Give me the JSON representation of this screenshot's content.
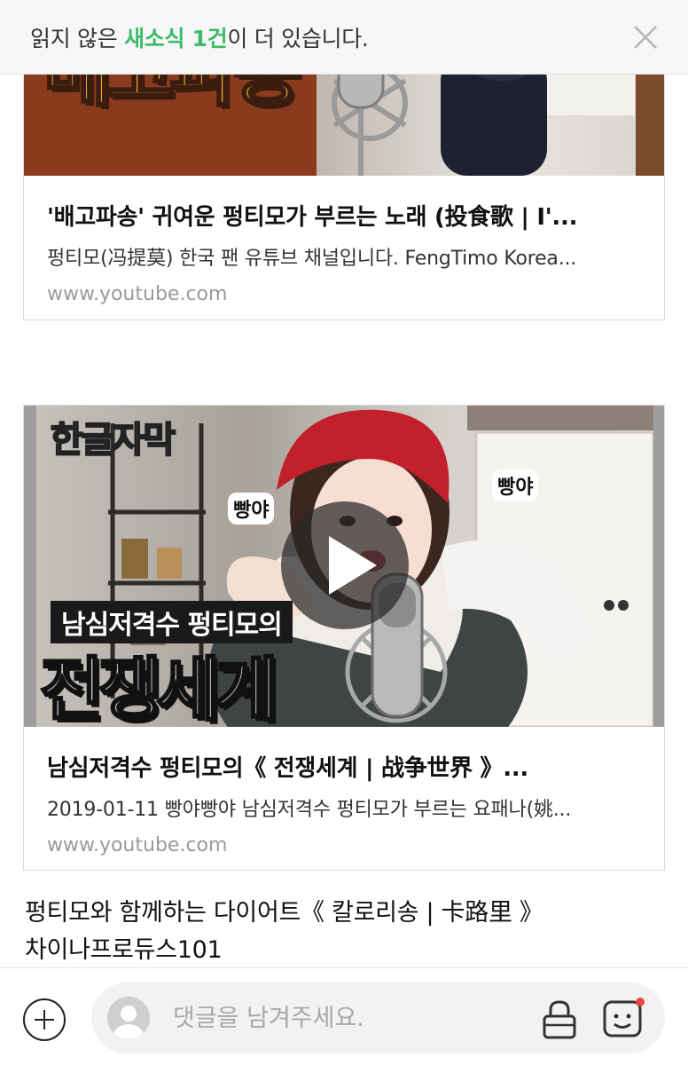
{
  "notice": {
    "prefix": "읽지 않은 ",
    "highlight": "새소식 1건",
    "suffix": "이 더 있습니다."
  },
  "cards": [
    {
      "thumb_caption": "배고파송",
      "title": "'배고파송' 귀여운 펑티모가 부르는 노래 (投食歌 | I'...",
      "desc": "펑티모(冯提莫) 한국 팬 유튜브 채널입니다. FengTimo Korea...",
      "url": "www.youtube.com"
    },
    {
      "thumb_corner": "한글자막",
      "thumb_bubble_1": "빵야",
      "thumb_bubble_2": "빵야",
      "thumb_subtitle": "남심저격수 펑티모의",
      "thumb_caption": "전쟁세계",
      "title": "남심저격수 펑티모의《 전쟁세계 | 战争世界 》...",
      "desc": "2019-01-11 빵야빵야 남심저격수 펑티모가 부르는 요패나(姚...",
      "url": "www.youtube.com"
    }
  ],
  "post_text": {
    "line1": "펑티모와 함께하는 다이어트《 칼로리송 | 卡路里 》",
    "line2": "차이나프로듀스101"
  },
  "comment": {
    "placeholder": "댓글을 남겨주세요."
  },
  "colors": {
    "accent": "#3cbc6a",
    "badge": "#e8453c",
    "banner_orange": "#f05a1e"
  },
  "icons": {
    "close": "close-icon",
    "play": "play-icon",
    "plus": "plus-icon",
    "lock": "lock-icon",
    "emoji": "emoji-icon",
    "avatar": "avatar-icon"
  }
}
